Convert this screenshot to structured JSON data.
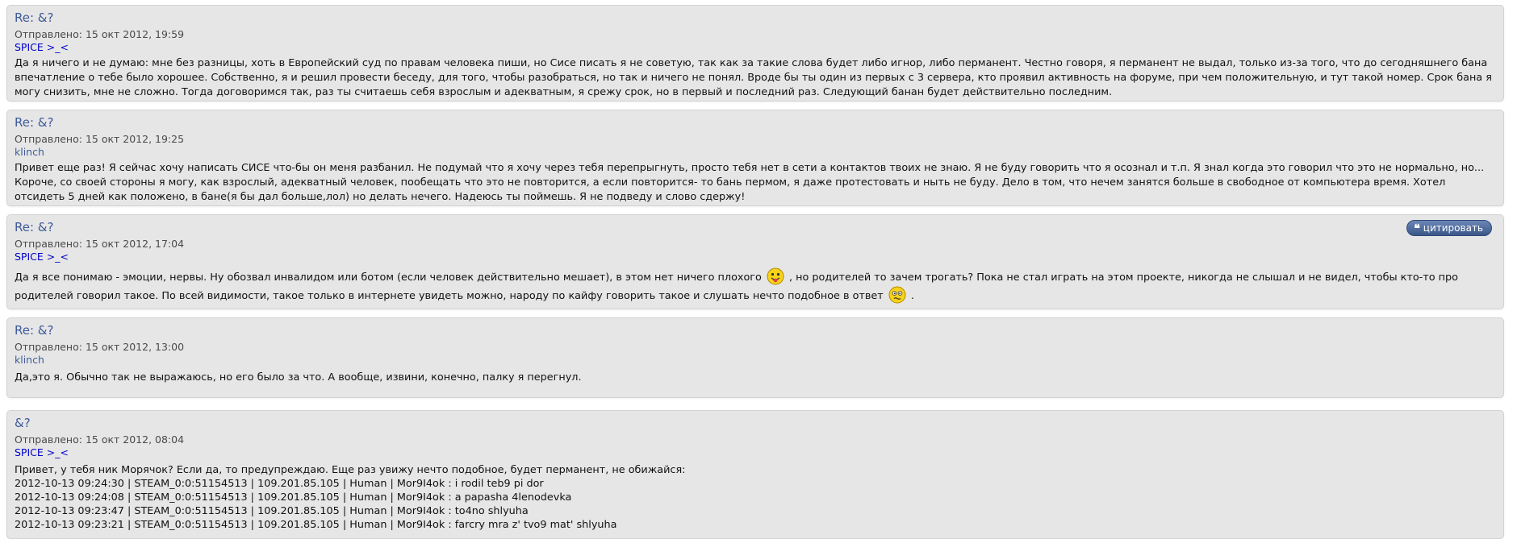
{
  "posts": [
    {
      "title": "Re: &?",
      "sent": "Отправлено: 15 окт 2012, 19:59",
      "author": "SPICE >_<",
      "body": "Да я ничего и не думаю: мне без разницы, хоть в Европейский суд по правам человека пиши, но Сисе писать я не советую, так как за такие слова будет либо игнор, либо перманент. Честно говоря, я перманент не выдал, только из-за того, что до сегодняшнего бана впечатление о тебе было хорошее. Собственно, я и решил провести беседу, для того, чтобы разобраться, но так и ничего не понял. Вроде бы ты один из первых с 3 сервера, кто проявил активность на форуме, при чем положительную, и тут такой номер. Срок бана я могу снизить, мне не сложно. Тогда договоримся так, раз ты считаешь себя взрослым и адекватным, я срежу срок, но в первый и последний раз. Следующий банан будет действительно последним."
    },
    {
      "title": "Re: &?",
      "sent": "Отправлено: 15 окт 2012, 19:25",
      "author": "klinch",
      "body": "Привет еще раз! Я сейчас хочу написать СИСЕ что-бы он меня разбанил. Не подумай что я хочу через тебя перепрыгнуть, просто тебя нет в сети а контактов твоих не знаю. Я не буду говорить что я осознал и т.п. Я знал когда это говорил что это не нормально, но... Короче, со своей стороны я могу, как взрослый, адекватный человек, пообещать что это не повторится, а если повторится- то бань пермом, я даже протестовать и ныть не буду. Дело в том, что нечем занятся больше в свободное от компьютера время. Хотел отсидеть 5 дней как положено, в бане(я бы дал больше,лол) но делать нечего. Надеюсь ты поймешь. Я не подведу и слово сдержу!"
    },
    {
      "title": "Re: &?",
      "sent": "Отправлено: 15 окт 2012, 17:04",
      "author": "SPICE >_<",
      "quote_label": "цитировать",
      "body_part1": "Да я все понимаю - эмоции, нервы. Ну обозвал инвалидом или ботом (если человек действительно мешает), в этом нет ничего плохого",
      "body_part2": ", но родителей то зачем трогать? Пока не стал играть на этом проекте, никогда не слышал и не видел, чтобы кто-то про родителей говорил такое. По всей видимости, такое только в интернете увидеть можно, народу по кайфу говорить такое и слушать нечто подобное в ответ",
      "body_part3": "."
    },
    {
      "title": "Re: &?",
      "sent": "Отправлено: 15 окт 2012, 13:00",
      "author": "klinch",
      "body": "Да,это я. Обычно так не выражаюсь, но его было за что. А вообще, извини, конечно, палку я перегнул."
    },
    {
      "title": "&?",
      "sent": "Отправлено: 15 окт 2012, 08:04",
      "author": "SPICE >_<",
      "body": "Привет, у тебя ник Морячок? Если да, то предупреждаю. Еще раз увижу нечто подобное, будет перманент, не обижайся:",
      "log": [
        "2012-10-13 09:24:30 | STEAM_0:0:51154513 | 109.201.85.105 | Human | Mor9I4ok : i rodil teb9 pi dor",
        "2012-10-13 09:24:08 | STEAM_0:0:51154513 | 109.201.85.105 | Human | Mor9I4ok : a papasha 4lenodevka",
        "2012-10-13 09:23:47 | STEAM_0:0:51154513 | 109.201.85.105 | Human | Mor9I4ok : to4no shlyuha",
        "2012-10-13 09:23:21 | STEAM_0:0:51154513 | 109.201.85.105 | Human | Mor9I4ok : farcry mra z' tvo9 mat' shlyuha"
      ]
    }
  ]
}
